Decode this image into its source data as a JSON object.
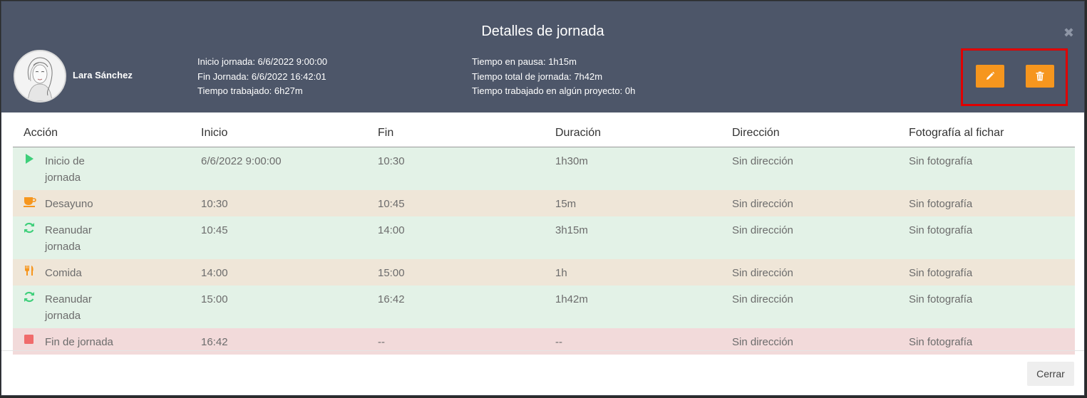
{
  "modal": {
    "title": "Detalles de jornada",
    "close_symbol": "✖"
  },
  "user": {
    "name": "Lara Sánchez",
    "avatar_icon": "user-portrait-icon"
  },
  "summary": {
    "inicio": "Inicio jornada: 6/6/2022 9:00:00",
    "fin": "Fin Jornada: 6/6/2022 16:42:01",
    "trabajado": "Tiempo trabajado: 6h27m",
    "pausa": "Tiempo en pausa: 1h15m",
    "total": "Tiempo total de jornada: 7h42m",
    "proyecto": "Tiempo trabajado en algún proyecto: 0h"
  },
  "actions": {
    "edit_icon": "pencil-icon",
    "delete_icon": "trash-icon",
    "accent": "#f6961e",
    "highlight": "#e00000"
  },
  "table": {
    "headers": [
      "Acción",
      "Inicio",
      "Fin",
      "Duración",
      "Dirección",
      "Fotografía al fichar"
    ],
    "rows": [
      {
        "icon": "play-icon",
        "type": "green",
        "accion": "Inicio de jornada",
        "inicio": "6/6/2022 9:00:00",
        "fin": "10:30",
        "duracion": "1h30m",
        "direccion": "Sin dirección",
        "foto": "Sin fotografía"
      },
      {
        "icon": "coffee-icon",
        "type": "brown",
        "accion": "Desayuno",
        "inicio": "10:30",
        "fin": "10:45",
        "duracion": "15m",
        "direccion": "Sin dirección",
        "foto": "Sin fotografía"
      },
      {
        "icon": "refresh-icon",
        "type": "green",
        "accion": "Reanudar jornada",
        "inicio": "10:45",
        "fin": "14:00",
        "duracion": "3h15m",
        "direccion": "Sin dirección",
        "foto": "Sin fotografía"
      },
      {
        "icon": "cutlery-icon",
        "type": "brown",
        "accion": "Comida",
        "inicio": "14:00",
        "fin": "15:00",
        "duracion": "1h",
        "direccion": "Sin dirección",
        "foto": "Sin fotografía"
      },
      {
        "icon": "refresh-icon",
        "type": "green",
        "accion": "Reanudar jornada",
        "inicio": "15:00",
        "fin": "16:42",
        "duracion": "1h42m",
        "direccion": "Sin dirección",
        "foto": "Sin fotografía"
      },
      {
        "icon": "stop-icon",
        "type": "red",
        "accion": "Fin de jornada",
        "inicio": "16:42",
        "fin": "--",
        "duracion": "--",
        "direccion": "Sin dirección",
        "foto": "Sin fotografía"
      }
    ]
  },
  "footer": {
    "close_label": "Cerrar"
  },
  "colors": {
    "header_bg": "#4d5669",
    "row_green": "#e3f2e7",
    "row_brown": "#efe6d8",
    "row_red": "#f2dada",
    "icon_green": "#3ecf7a",
    "icon_orange": "#f6961e",
    "icon_red": "#f06b6b"
  }
}
